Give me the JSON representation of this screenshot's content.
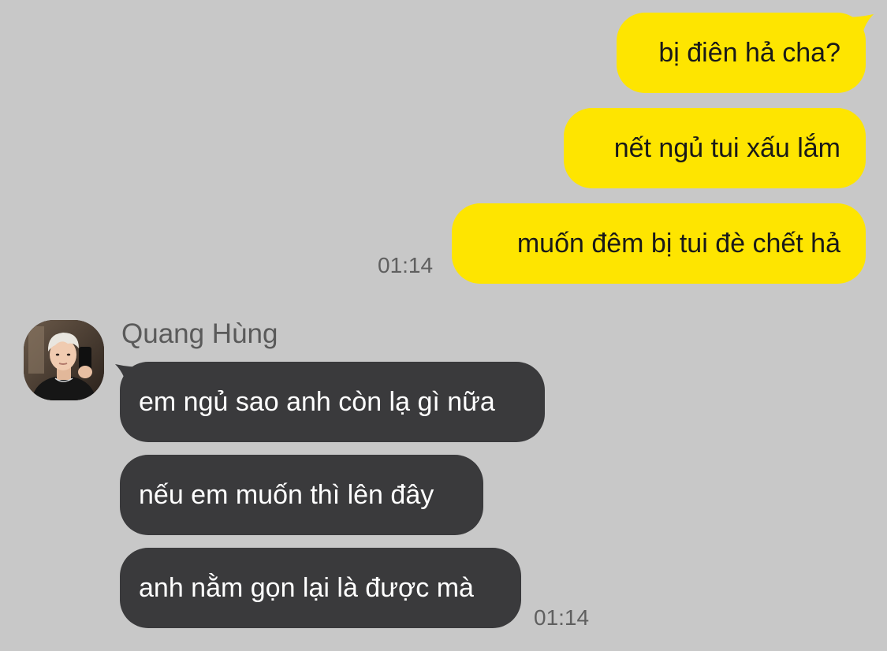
{
  "outgoing": [
    {
      "text": "bị điên hả cha?"
    },
    {
      "text": "nết ngủ tui xấu lắm"
    },
    {
      "text": "muốn đêm bị tui đè chết hả"
    }
  ],
  "outgoing_time": "01:14",
  "incoming_sender": "Quang Hùng",
  "incoming": [
    {
      "text": "em ngủ sao anh còn lạ gì nữa"
    },
    {
      "text": "nếu em muốn thì lên đây"
    },
    {
      "text": "anh nằm gọn lại là được mà"
    }
  ],
  "incoming_time": "01:14",
  "colors": {
    "background": "#c8c8c8",
    "outgoing_bubble": "#fee500",
    "incoming_bubble": "#3a3a3c"
  }
}
